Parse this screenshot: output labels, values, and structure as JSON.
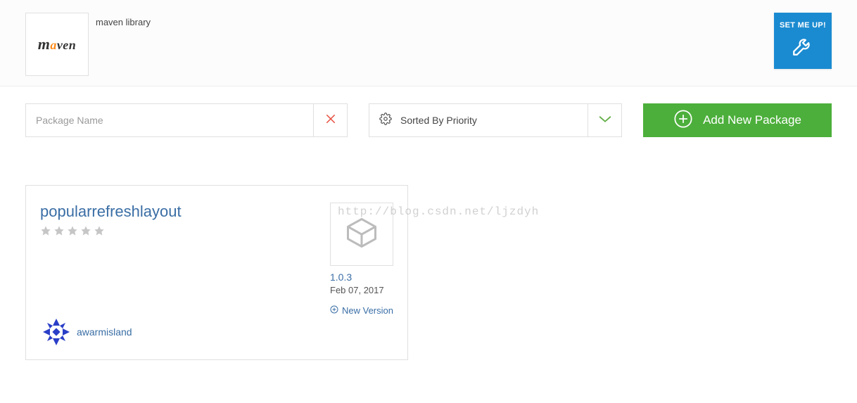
{
  "header": {
    "logo_segments": {
      "prefix": "m",
      "highlight": "a",
      "suffix": "ven"
    },
    "library_title": "maven library",
    "setmeup_label": "SET ME UP!"
  },
  "toolbar": {
    "search_placeholder": "Package Name",
    "search_value": "",
    "sort_label": "Sorted By Priority",
    "add_label": "Add New Package"
  },
  "package": {
    "name": "popularrefreshlayout",
    "rating": 0,
    "version": "1.0.3",
    "date": "Feb 07, 2017",
    "new_version_label": "New Version",
    "owner": "awarmisland"
  },
  "watermark": "http://blog.csdn.net/ljzdyh",
  "colors": {
    "link": "#3a6ea5",
    "primary_blue": "#1b8bd1",
    "primary_green": "#4caf3b",
    "clear_red": "#e74c3c",
    "caret_green": "#66b04a",
    "star_grey": "#c6c6c6"
  }
}
